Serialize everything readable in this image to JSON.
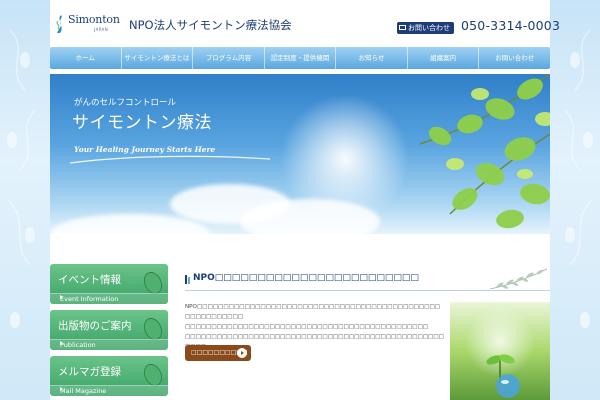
{
  "header": {
    "logo_text": "Simonton",
    "logo_sub": "JAPAN",
    "org_name": "NPO法人サイモントン療法協会",
    "contact_label": "お問い合わせ",
    "phone": "050-3314-0003"
  },
  "nav": {
    "items": [
      {
        "label": "ホーム"
      },
      {
        "label": "サイモントン療法とは"
      },
      {
        "label": "プログラム内容"
      },
      {
        "label": "認定制度・提供機関"
      },
      {
        "label": "お知らせ"
      },
      {
        "label": "組織案内"
      },
      {
        "label": "お問い合わせ"
      }
    ]
  },
  "hero": {
    "subtitle": "がんのセルフコントロール",
    "title": "サイモントン療法",
    "tagline": "Your Healing Journey Starts Here"
  },
  "sidebar": {
    "items": [
      {
        "title": "イベント情報",
        "sub": "Event Information"
      },
      {
        "title": "出版物のご案内",
        "sub": "Publication"
      },
      {
        "title": "メルマガ登録",
        "sub": "Mail Magazine"
      }
    ]
  },
  "content": {
    "section_title": "NPO□□□□□□□□□□□□□□□□□□□□□□□□",
    "body_lines": [
      "NPO□□□□□□□□□□□□□□□□□□□□□□□□□□□□□□□□□□□□□□□□□□□□□□□□□□□□□□□□□",
      "□□□□□□□□□□□□□□□□□□□□□□□□□□□□□□□□□□□□□□□□□□□□□□",
      "□□□□□□□□□□□□□□□□□□□□□□□□□□□□□□□□□□□□□□□□□□□□□□□□□□□□□"
    ],
    "detail_button": "□□□□□□□□□□"
  },
  "colors": {
    "navy": "#1d3c78",
    "nav_blue": "#5aa8e0",
    "side_green": "#3aa265",
    "button_brown": "#8a4a1c"
  }
}
